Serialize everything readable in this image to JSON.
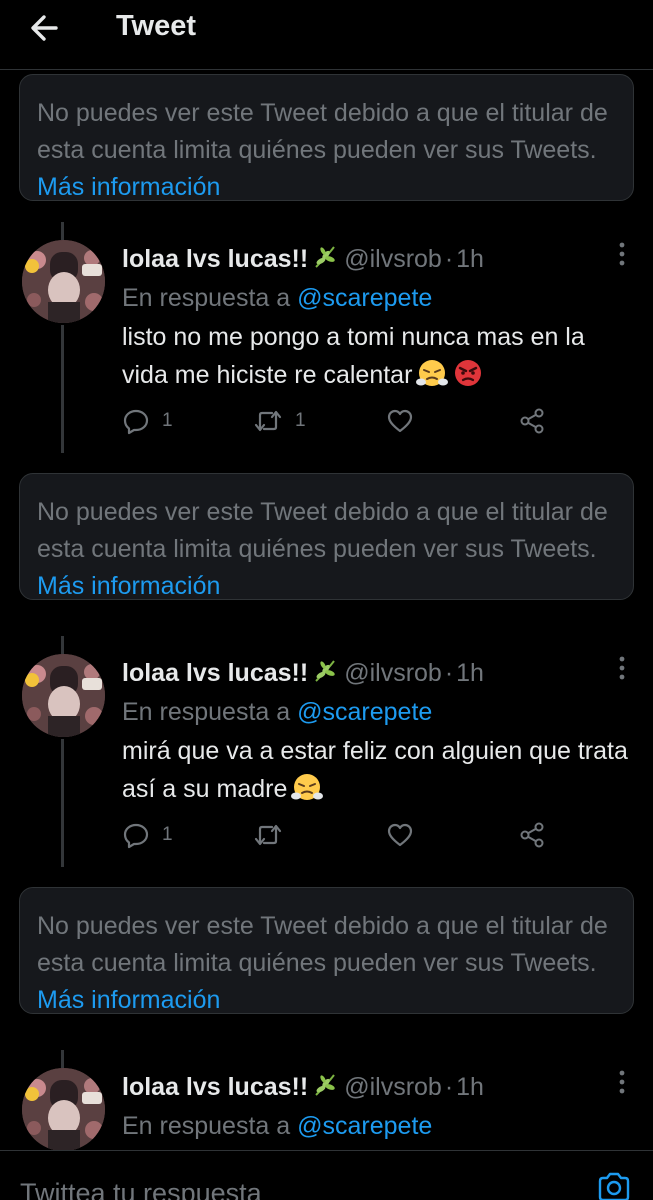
{
  "header": {
    "title": "Tweet"
  },
  "notice": {
    "text": "No puedes ver este Tweet debido a que el titular de esta cuenta limita quiénes pueden ver sus Tweets.",
    "link_label": "Más información"
  },
  "tweets": [
    {
      "display_name": "lolaa lvs lucas!!",
      "handle": "@ilvsrob",
      "separator": "·",
      "time": "1h",
      "reply_prefix": "En respuesta a",
      "reply_mention": "@scarepete",
      "text": "listo no me pongo a tomi nunca mas en la vida me hiciste re calentar",
      "emojis": [
        "face-with-steam-from-nose",
        "pouting-face"
      ],
      "reply_count": "1",
      "retweet_count": "1",
      "like_count": ""
    },
    {
      "display_name": "lolaa lvs lucas!!",
      "handle": "@ilvsrob",
      "separator": "·",
      "time": "1h",
      "reply_prefix": "En respuesta a",
      "reply_mention": "@scarepete",
      "text": "mirá que va a estar feliz con alguien que trata así a su madre",
      "emojis": [
        "face-with-steam-from-nose"
      ],
      "reply_count": "1",
      "retweet_count": "",
      "like_count": ""
    },
    {
      "display_name": "lolaa lvs lucas!!",
      "handle": "@ilvsrob",
      "separator": "·",
      "time": "1h",
      "reply_prefix": "En respuesta a",
      "reply_mention": "@scarepete"
    }
  ],
  "compose": {
    "placeholder": "Twittea tu respuesta"
  },
  "icons": {
    "back": "arrow-left-icon",
    "leaf": "herb-icon",
    "more": "more-vertical-icon",
    "reply": "reply-bubble-icon",
    "retweet": "retweet-icon",
    "like": "heart-icon",
    "share": "share-icon",
    "camera": "camera-icon"
  },
  "colors": {
    "background": "#000000",
    "accent": "#1d9bf0",
    "muted_text": "#71767b",
    "primary_text": "#e7e9ea",
    "notice_background": "#16181c"
  }
}
